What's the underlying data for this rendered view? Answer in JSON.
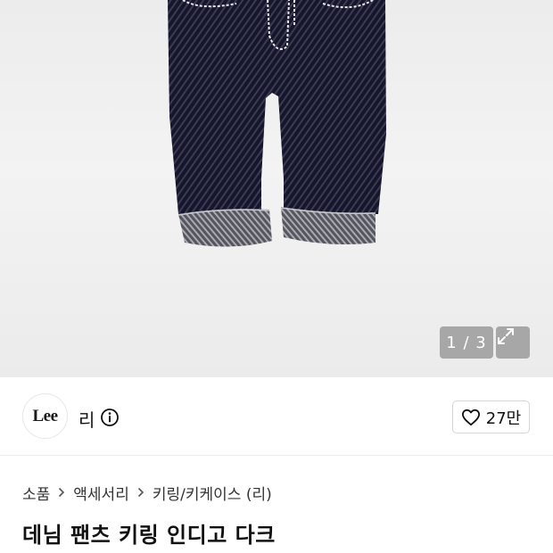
{
  "gallery": {
    "counter": "1 / 3",
    "image_alt": "denim-pants-keyring"
  },
  "brand": {
    "logo_text": "Lee",
    "name": "리"
  },
  "like": {
    "count": "27만"
  },
  "breadcrumb": [
    "소품",
    "액세서리",
    "키링/키케이스 (리)"
  ],
  "product": {
    "title": "데님 팬츠 키링 인디고 다크"
  },
  "colors": {
    "denim": "#14142a",
    "cuff": "#6b6b74",
    "stitch": "#e8e8e8"
  }
}
